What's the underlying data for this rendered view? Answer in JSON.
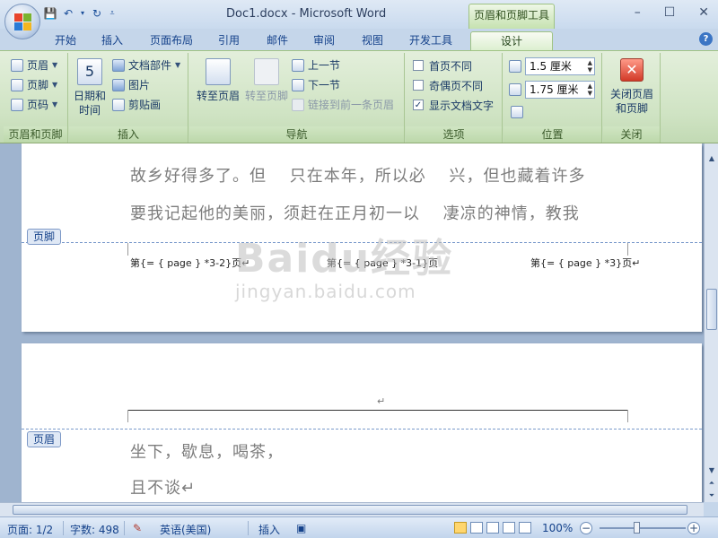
{
  "window": {
    "title": "Doc1.docx - Microsoft Word",
    "contextual_tab": "页眉和页脚工具",
    "controls": [
      "–",
      "☐",
      "✕"
    ]
  },
  "tabs": [
    {
      "label": "开始"
    },
    {
      "label": "插入"
    },
    {
      "label": "页面布局"
    },
    {
      "label": "引用"
    },
    {
      "label": "邮件"
    },
    {
      "label": "审阅"
    },
    {
      "label": "视图"
    },
    {
      "label": "开发工具"
    },
    {
      "label": "设计"
    }
  ],
  "ribbon": {
    "group_header_footer": {
      "label": "页眉和页脚",
      "header": "页眉",
      "footer": "页脚",
      "page_number": "页码"
    },
    "group_insert": {
      "label": "插入",
      "date_time": "日期和时间",
      "date_time_line1": "日期和",
      "date_time_line2": "时间",
      "quick_parts": "文档部件",
      "picture": "图片",
      "clip_art": "剪贴画"
    },
    "group_nav": {
      "label": "导航",
      "goto_header": "转至页眉",
      "goto_footer": "转至页脚",
      "prev_section": "上一节",
      "next_section": "下一节",
      "link_previous": "链接到前一条页眉"
    },
    "group_options": {
      "label": "选项",
      "diff_first": "首页不同",
      "diff_odd_even": "奇偶页不同",
      "show_doc_text": "显示文档文字",
      "diff_first_checked": false,
      "diff_odd_even_checked": false,
      "show_doc_text_checked": true
    },
    "group_position": {
      "label": "位置",
      "header_from_top": "1.5 厘米",
      "footer_from_bottom": "1.75 厘米"
    },
    "group_close": {
      "label": "关闭",
      "close_line1": "关闭页眉",
      "close_line2": "和页脚"
    }
  },
  "document": {
    "page1_lines": [
      "故乡好得多了。但　 只在本年，所以必　 兴，但也藏着许多",
      "要我记起他的美丽，须赶在正月初一以　 凄凉的神情，教我"
    ],
    "footer_tag": "页脚",
    "footer_left": "第{= { page } *3-2}页↵",
    "footer_mid": "第{= { page } *3-1}页",
    "footer_right": "第{= { page } *3}页↵",
    "page2_para_mark": "↵",
    "header_tag": "页眉",
    "page2_lines": [
      "坐下，歇息，喝茶，",
      "且不谈↵"
    ]
  },
  "watermark": {
    "main": "Baidu经验",
    "sub": "jingyan.baidu.com"
  },
  "status_bar": {
    "page": "页面: 1/2",
    "word_count": "字数: 498",
    "language": "英语(美国)",
    "insert_mode": "插入",
    "zoom": "100%"
  }
}
